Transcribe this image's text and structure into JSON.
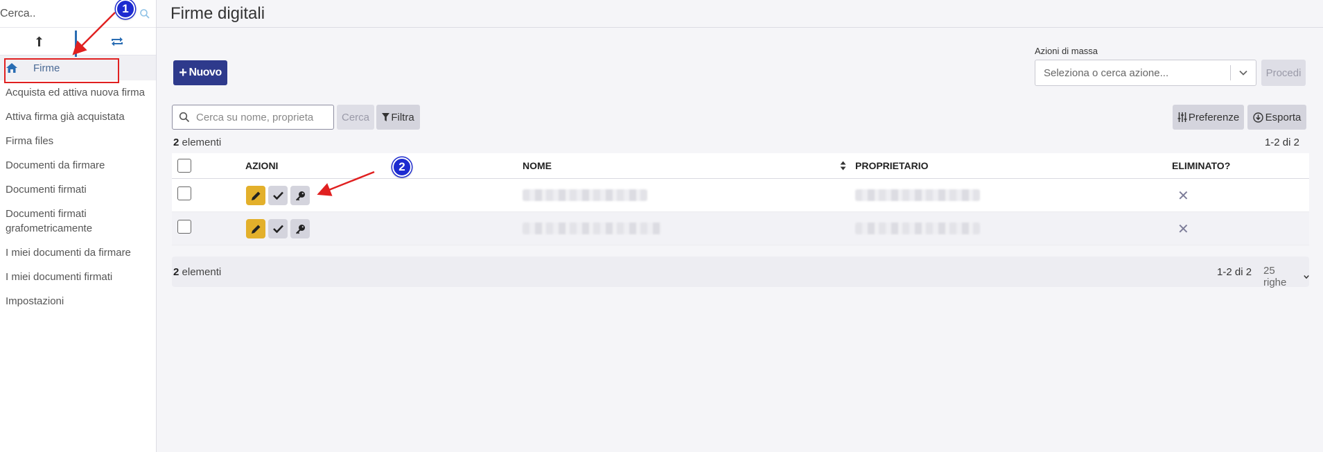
{
  "sidebar": {
    "search_placeholder": "Cerca..",
    "items": [
      {
        "label": "Firme",
        "active": true
      },
      {
        "label": "Acquista ed attiva nuova firma"
      },
      {
        "label": "Attiva firma già acquistata"
      },
      {
        "label": "Firma files"
      },
      {
        "label": "Documenti da firmare"
      },
      {
        "label": "Documenti firmati"
      },
      {
        "label": "Documenti firmati grafometricamente"
      },
      {
        "label": "I miei documenti da firmare"
      },
      {
        "label": "I miei documenti firmati"
      },
      {
        "label": "Impostazioni"
      }
    ]
  },
  "page": {
    "title": "Firme digitali"
  },
  "toolbar": {
    "new_label": "Nuovo",
    "mass_actions_label": "Azioni di massa",
    "mass_actions_placeholder": "Seleziona o cerca azione...",
    "proceed_label": "Procedi",
    "search_placeholder": "Cerca su nome, proprieta",
    "search_label": "Cerca",
    "filter_label": "Filtra",
    "preferences_label": "Preferenze",
    "export_label": "Esporta"
  },
  "table": {
    "count_number": "2",
    "count_word": "elementi",
    "range": "1-2 di 2",
    "columns": [
      "AZIONI",
      "NOME",
      "PROPRIETARIO",
      "ELIMINATO?"
    ],
    "rows": [
      {
        "nome": "",
        "proprietario": "",
        "eliminato": "✕"
      },
      {
        "nome": "",
        "proprietario": "",
        "eliminato": "✕"
      }
    ]
  },
  "footer": {
    "count_number": "2",
    "count_word": "elementi",
    "range": "1-2 di 2",
    "rows_per_page": "25 righe"
  },
  "annotations": {
    "badge1": "1",
    "badge2": "2"
  },
  "colors": {
    "primary": "#2e3a8c",
    "edit": "#e3b02b",
    "annotation_red": "#e02020",
    "badge_blue": "#1d2bd0"
  }
}
